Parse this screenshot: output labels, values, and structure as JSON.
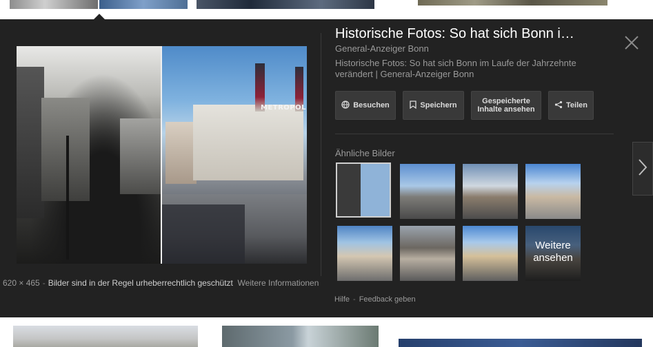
{
  "panel": {
    "title": "Historische Fotos: So hat sich Bonn i…",
    "source": "General-Anzeiger Bonn",
    "description": "Historische Fotos: So hat sich Bonn im Laufe der Jahrzehnte verändert | General-Anzeiger Bonn",
    "main_image_sign": "METROPOL",
    "actions": {
      "visit": "Besuchen",
      "save": "Speichern",
      "saved": "Gespeicherte Inhalte ansehen",
      "share": "Teilen"
    },
    "similar": {
      "heading": "Ähnliche Bilder",
      "more_label": "Weitere ansehen"
    },
    "caption": {
      "dimensions": "620 × 465",
      "separator": "-",
      "copyright": "Bilder sind in der Regel urheberrechtlich geschützt",
      "more_info": "Weitere Informationen"
    },
    "footer": {
      "help": "Hilfe",
      "separator": "-",
      "feedback": "Feedback geben"
    }
  },
  "colors": {
    "panel_background": "#222222",
    "button_background": "#393939",
    "text_primary": "#ffffff",
    "text_secondary": "#9a9a9a"
  },
  "icons": [
    "globe-icon",
    "bookmark-icon",
    "share-icon",
    "close-icon",
    "chevron-right-icon"
  ]
}
